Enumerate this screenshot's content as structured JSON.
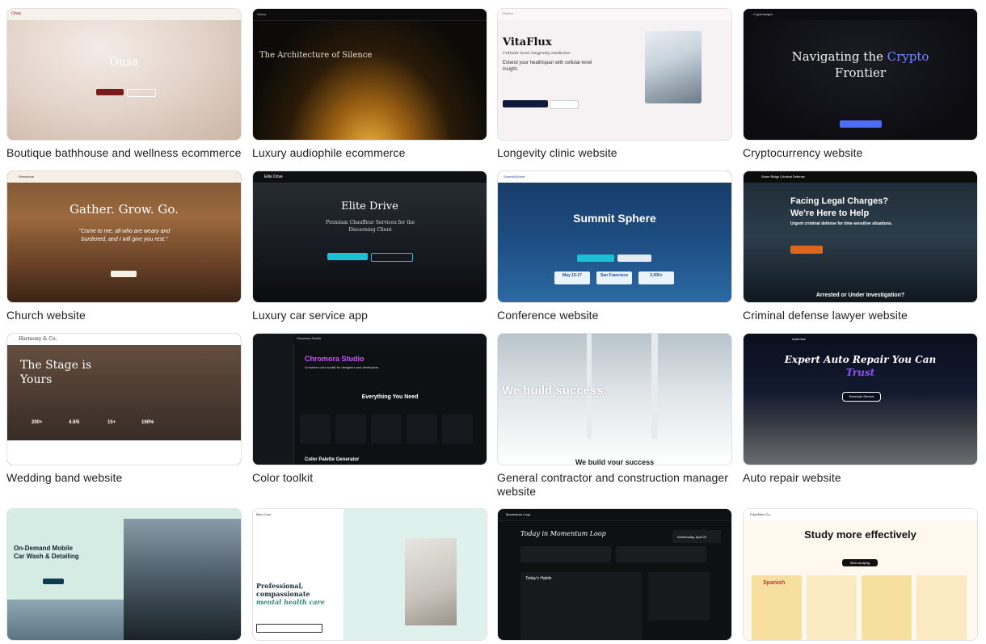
{
  "gallery": {
    "cards": [
      {
        "caption": "Boutique bathhouse and wellness ecommerce",
        "title": "Onsa",
        "brand": "Onsa"
      },
      {
        "caption": "Luxury audiophile ecommerce",
        "title": "The Architecture of Silence",
        "brand": "Sonus"
      },
      {
        "caption": "Longevity clinic website",
        "title": "VitaFlux",
        "subtitle": "Cellular level longevity medicine.",
        "body": "Extend your healthspan with cellular-level insight.",
        "brand": "VitaFlux"
      },
      {
        "caption": "Cryptocurrency website",
        "title_a": "Navigating the ",
        "title_b": "Crypto",
        "title_c": "Frontier",
        "brand": "CryptoInsight"
      },
      {
        "caption": "Church website",
        "title": "Gather. Grow. Go.",
        "quote": "\"Come to me, all who are weary and burdened, and I will give you rest.\"",
        "brand": "Riverstone"
      },
      {
        "caption": "Luxury car service app",
        "title": "Elite Drive",
        "subtitle": "Premium Chauffeur Services for the Discerning Client",
        "brand": "Elite Drive"
      },
      {
        "caption": "Conference website",
        "title": "Summit Sphere",
        "stat1": "May 15-17",
        "stat2": "San Francisco",
        "stat3": "2,000+",
        "brand": "SummitSphere"
      },
      {
        "caption": "Criminal defense lawyer website",
        "title_a": "Facing Legal Charges?",
        "title_b": "We're Here to Help",
        "subtitle": "Urgent criminal defense for time-sensitive situations.",
        "footer": "Arrested or Under Investigation?",
        "brand": "Stone Ridge Criminal Defense"
      },
      {
        "caption": "Wedding band website",
        "title_a": "The Stage is",
        "title_b": "Yours",
        "stats": [
          "200+",
          "4.9/5",
          "15+",
          "100%"
        ],
        "brand": "Harmony & Co."
      },
      {
        "caption": "Color toolkit",
        "title": "Chromora Studio",
        "subtitle": "A modern color toolkit for designers and developers.",
        "section": "Everything You Need",
        "footer": "Color Palette Generator",
        "brand": "Chromora Studio"
      },
      {
        "caption": "General contractor and construction manager website",
        "title": "We build success.",
        "footer": "We build your success"
      },
      {
        "caption": "Auto repair website",
        "title_a": "Expert Auto Repair You Can",
        "title_b": "Trust",
        "cta": "Schedule Service",
        "brand": "AutoCare"
      },
      {
        "caption": "",
        "title_a": "On-Demand Mobile",
        "title_b": "Car Wash & Detailing"
      },
      {
        "caption": "",
        "title_a": "Professional,",
        "title_b": "compassionate",
        "title_c": "mental health care",
        "brand": "Mind Care"
      },
      {
        "caption": "",
        "title": "Today in Momentum Loop",
        "section": "Today's Habits",
        "brand": "Momentum Loop",
        "date": "Wednesday, April 22"
      },
      {
        "caption": "",
        "title": "Study more effectively",
        "cta": "Start studying",
        "deck1": "Spanish",
        "brand": "FlashMind Co."
      }
    ]
  },
  "colors": {
    "caption": "#1f1f1f",
    "border": "#e2e2e2"
  }
}
